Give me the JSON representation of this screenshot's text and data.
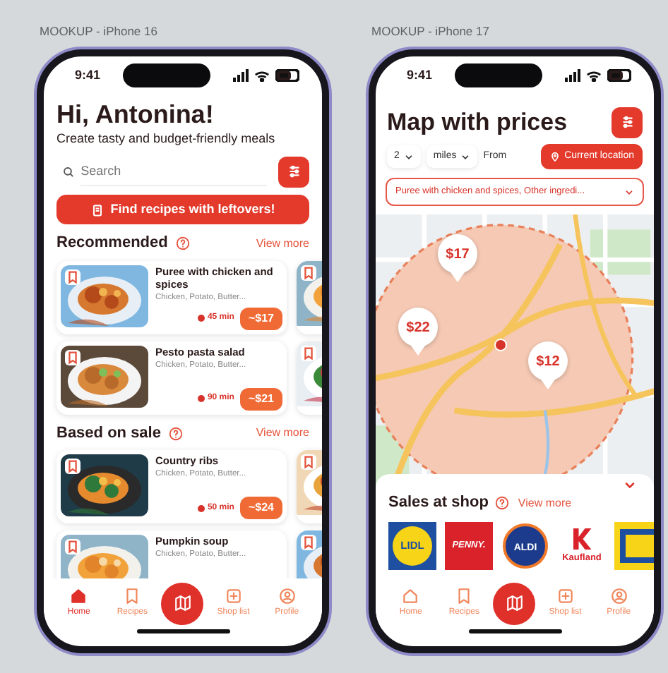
{
  "frame_1": {
    "caption": "MOOKUP - iPhone 16",
    "time": "9:41",
    "greeting": "Hi, Antonina!",
    "subtitle": "Create tasty and budget-friendly meals",
    "search": {
      "placeholder": "Search"
    },
    "leftovers_button": "Find recipes with leftovers!",
    "sections": [
      {
        "title": "Recommended",
        "link": "View more",
        "recipes": [
          {
            "title": "Puree with chicken and spices",
            "ingredients": "Chicken, Potato, Butter...",
            "time": "45 min",
            "price": "~$17"
          },
          {
            "title": "Pesto pasta salad",
            "ingredients": "Chicken, Potato, Butter...",
            "time": "90 min",
            "price": "~$21"
          }
        ]
      },
      {
        "title": "Based on sale",
        "link": "View more",
        "recipes": [
          {
            "title": "Country ribs",
            "ingredients": "Chicken, Potato, Butter...",
            "time": "50 min",
            "price": "~$24"
          },
          {
            "title": "Pumpkin soup",
            "ingredients": "Chicken, Potato, Butter..."
          }
        ]
      }
    ],
    "tabs": [
      {
        "kind": "tab",
        "label": "Home",
        "selected": true
      },
      {
        "kind": "tab",
        "label": "Recipes",
        "selected": false
      },
      {
        "kind": "center"
      },
      {
        "kind": "tab",
        "label": "Shop list",
        "selected": false
      },
      {
        "kind": "tab",
        "label": "Profile",
        "selected": false
      }
    ]
  },
  "frame_2": {
    "caption": "MOOKUP - iPhone 17",
    "time": "9:41",
    "title": "Map with prices",
    "distance": "2",
    "unit": "miles",
    "from_label": "From",
    "location_button": "Current location",
    "recipe_select": "Puree with chicken and spices, Other ingredi...",
    "pins": [
      {
        "price": "$17"
      },
      {
        "price": "$22"
      },
      {
        "price": "$12"
      }
    ],
    "shops_title": "Sales at shop",
    "shops_link": "View more",
    "shops": [
      {
        "kind": "lidl",
        "label": "LIDL"
      },
      {
        "kind": "penny",
        "label": "PENNY."
      },
      {
        "kind": "aldi",
        "label": "ALDI"
      },
      {
        "kind": "kaufland",
        "label": "Kaufland"
      },
      {
        "kind": "edeka"
      }
    ],
    "tabs": [
      {
        "kind": "tab",
        "label": "Home",
        "selected": false
      },
      {
        "kind": "tab",
        "label": "Recipes",
        "selected": false
      },
      {
        "kind": "center"
      },
      {
        "kind": "tab",
        "label": "Shop list",
        "selected": false
      },
      {
        "kind": "tab",
        "label": "Profile",
        "selected": false
      }
    ]
  }
}
